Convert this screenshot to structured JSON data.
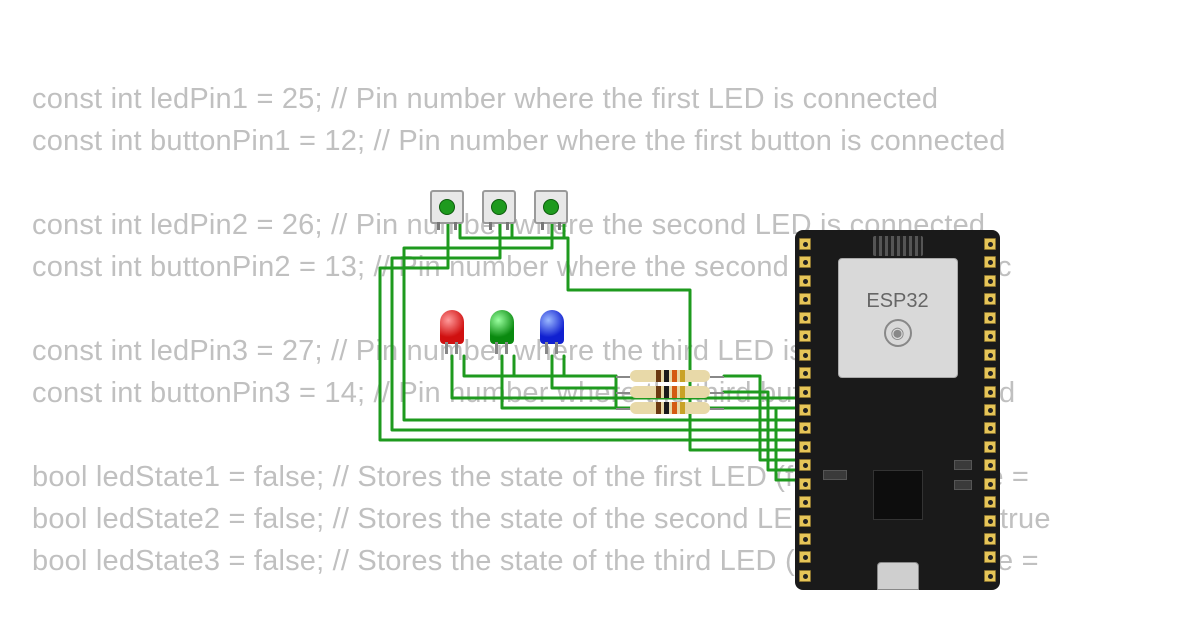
{
  "code_lines": [
    "const int ledPin1 = 25; // Pin number where the first LED is connected",
    "const int buttonPin1 = 12; // Pin number where the first button is connected",
    "",
    "const int ledPin2 = 26; // Pin number where the second LED is connected",
    "const int buttonPin2 = 13; // Pin number where the second button is connec",
    "",
    "const int ledPin3 = 27; // Pin number where the third LED is connected",
    "const int buttonPin3 = 14; // Pin number where the third button is connected",
    "",
    "bool ledState1 = false; // Stores the state of the first LED (false = OFF, true = ",
    "bool ledState2 = false; // Stores the state of the second LED (false = OFF, true",
    "bool ledState3 = false; // Stores the state of the third LED (false = OFF, true = "
  ],
  "board": {
    "label": "ESP32"
  },
  "components": {
    "buttons": [
      "button-1",
      "button-2",
      "button-3"
    ],
    "leds": [
      {
        "name": "led-red",
        "color": "red"
      },
      {
        "name": "led-green",
        "color": "green"
      },
      {
        "name": "led-blue",
        "color": "blue"
      }
    ],
    "resistor_bands": [
      "#6b3a12",
      "#1a1a1a",
      "#d45a12",
      "#c9a227"
    ]
  }
}
